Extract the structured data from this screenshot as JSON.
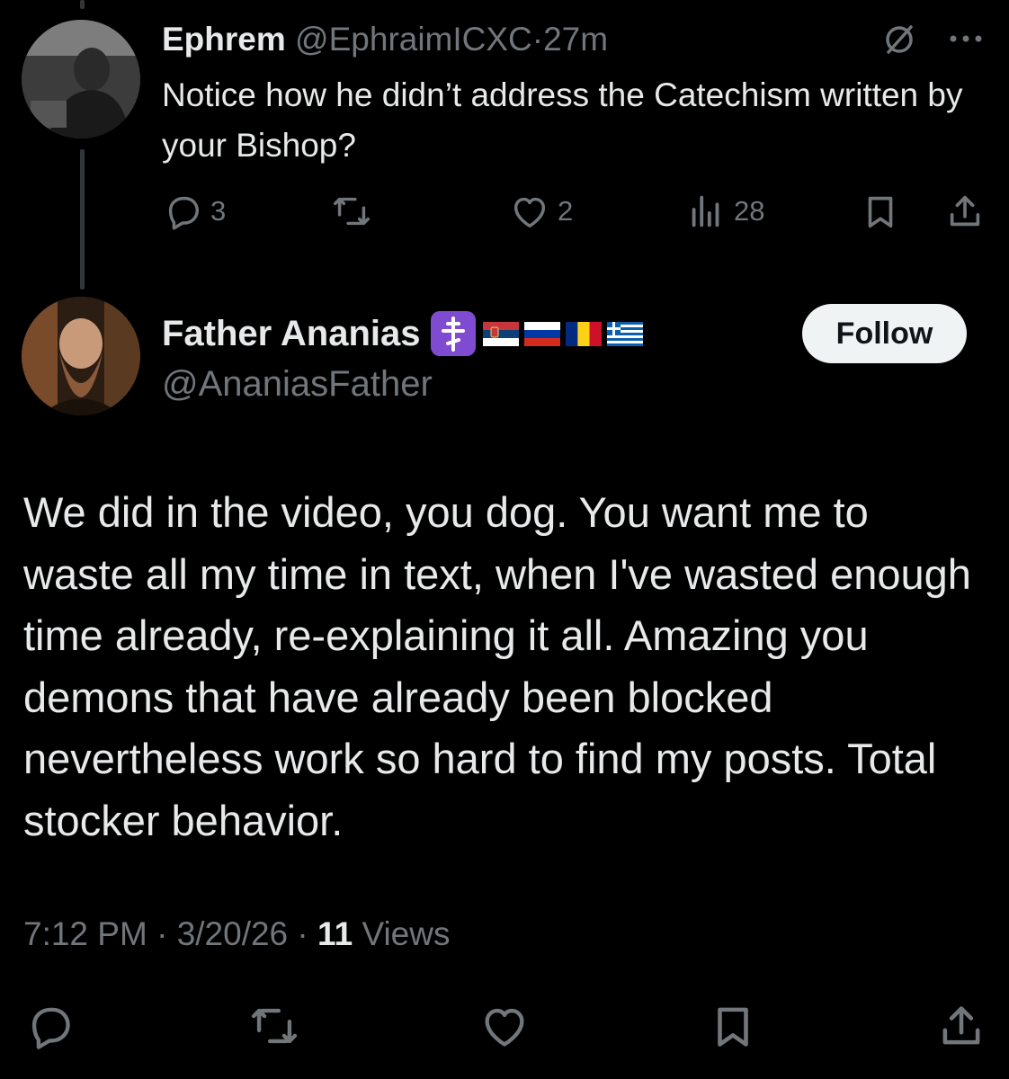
{
  "reply_tweet": {
    "author_name": "Ephrem",
    "handle": "@EphraimICXC",
    "separator": "·",
    "time_ago": "27m",
    "text": "Notice how he didn’t address the Catechism written by your Bishop?",
    "replies": "3",
    "retweets": "",
    "likes": "2",
    "views": "28",
    "icons": [
      "grok-icon",
      "more-icon",
      "reply-icon",
      "retweet-icon",
      "like-icon",
      "views-icon",
      "bookmark-icon",
      "share-icon"
    ]
  },
  "main_tweet": {
    "author_name": "Father Ananias",
    "handle": "@AnaniasFather",
    "follow_label": "Follow",
    "badges": [
      "orthodox-cross-emoji",
      "serbia-flag",
      "russia-flag",
      "romania-flag",
      "greece-flag"
    ],
    "text": "We did in the video, you dog. You want me to waste all my time in text, when I've wasted enough time already, re-explaining it all. Amazing you demons that have already been blocked nevertheless work so hard to find my posts. Total stocker behavior.",
    "time": "7:12 PM",
    "date": "3/20/26",
    "separator": "·",
    "views_count": "11",
    "views_label": "Views",
    "icons": [
      "reply-icon",
      "retweet-icon",
      "like-icon",
      "bookmark-icon",
      "share-icon"
    ]
  },
  "colors": {
    "background": "#000000",
    "text_primary": "#e7e9ea",
    "text_muted": "#71767b",
    "follow_bg": "#eff3f4",
    "thread_line": "#333639",
    "cross_badge": "#7f4bd1"
  }
}
